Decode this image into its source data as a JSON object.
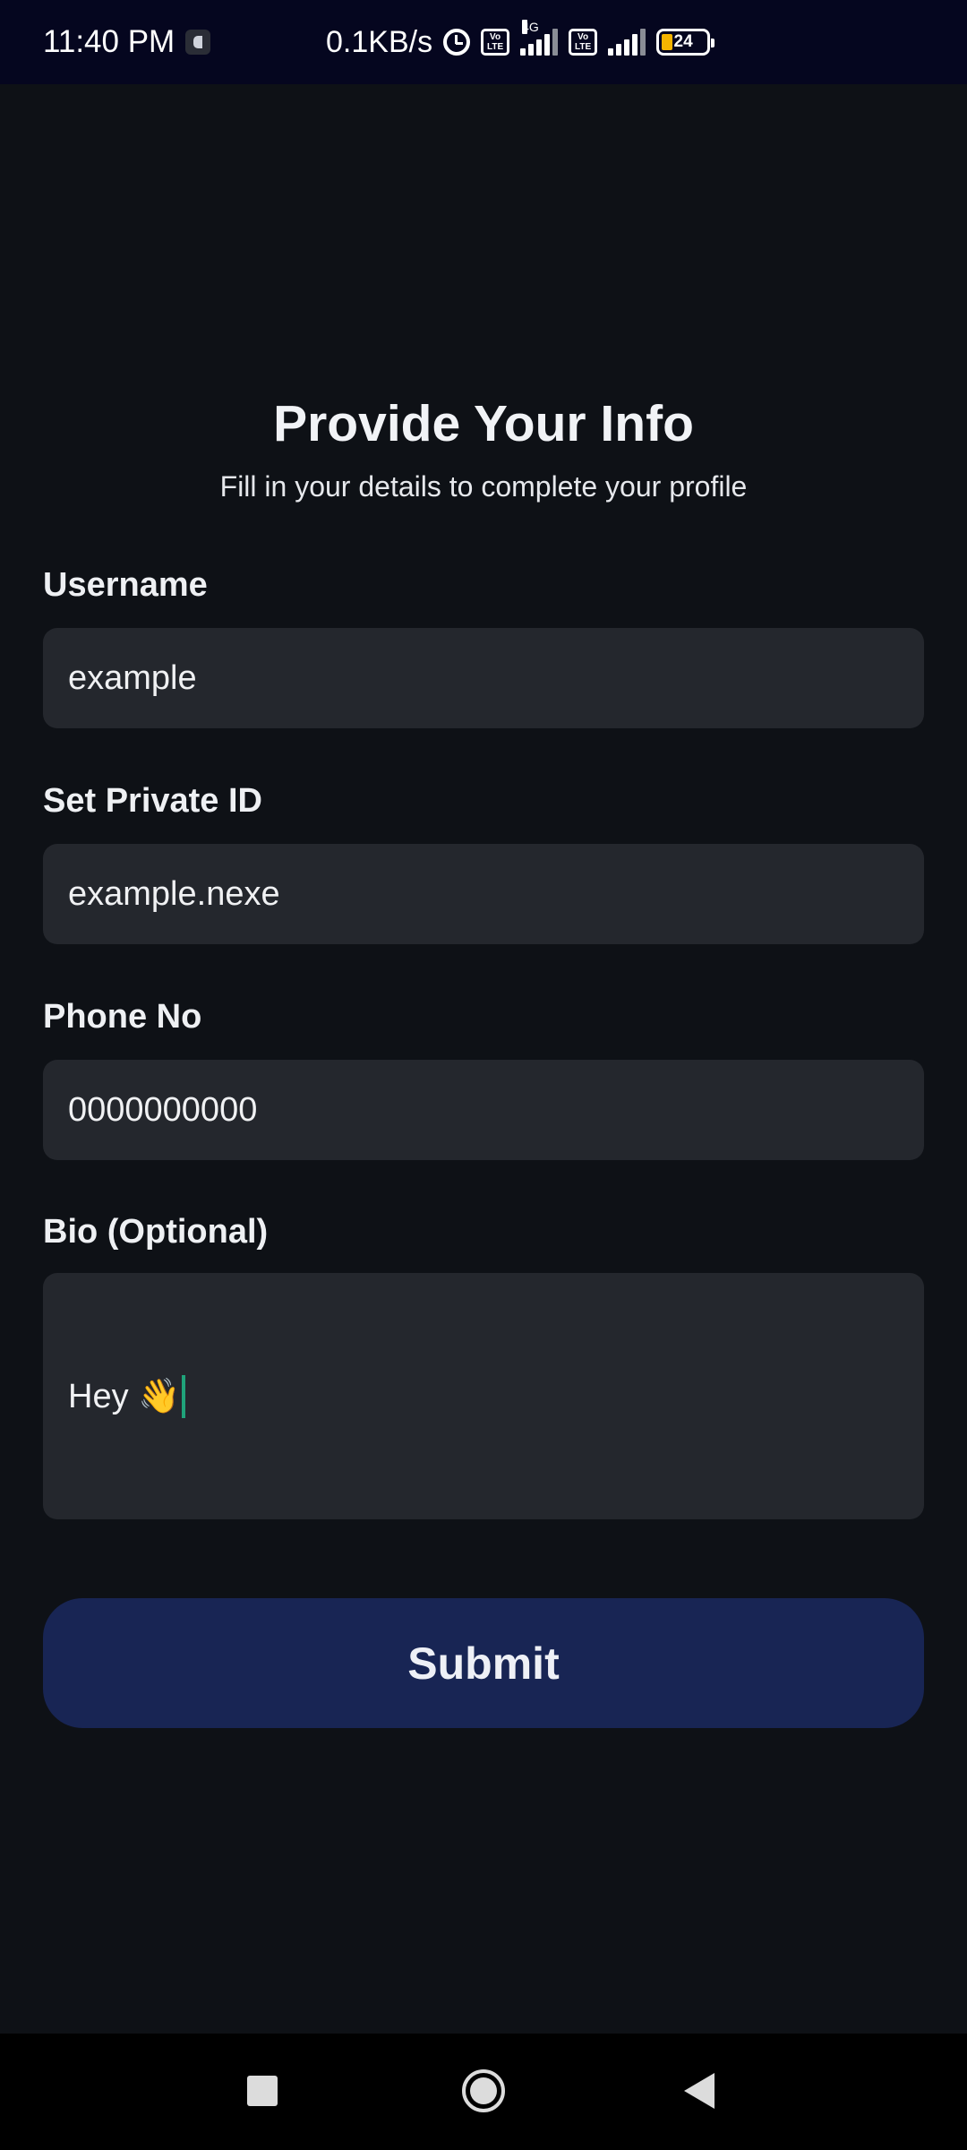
{
  "status_bar": {
    "time": "11:40 PM",
    "net_speed": "0.1KB/s",
    "volte_label": "Vo LTE",
    "network_type": "4G",
    "battery_level": "24",
    "icons": [
      "app-notification-icon",
      "alarm-icon",
      "volte-icon",
      "signal-icon",
      "volte-icon",
      "signal-icon",
      "battery-icon"
    ]
  },
  "header": {
    "title": "Provide Your Info",
    "subtitle": "Fill in your details to complete your profile"
  },
  "form": {
    "username": {
      "label": "Username",
      "value": "example"
    },
    "private_id": {
      "label": "Set Private ID",
      "value": "example.nexe"
    },
    "phone": {
      "label": "Phone No",
      "value": "0000000000"
    },
    "bio": {
      "label": "Bio (Optional)",
      "value": "Hey 👋"
    },
    "submit_label": "Submit"
  },
  "nav_bar": {
    "icons": [
      "recents-icon",
      "home-icon",
      "back-icon"
    ]
  },
  "colors": {
    "background": "#0e1116",
    "status_bar": "#05061f",
    "input_background": "#24272d",
    "button_background": "#182554",
    "caret": "#1fa37a",
    "battery_fill": "#f5b400"
  }
}
